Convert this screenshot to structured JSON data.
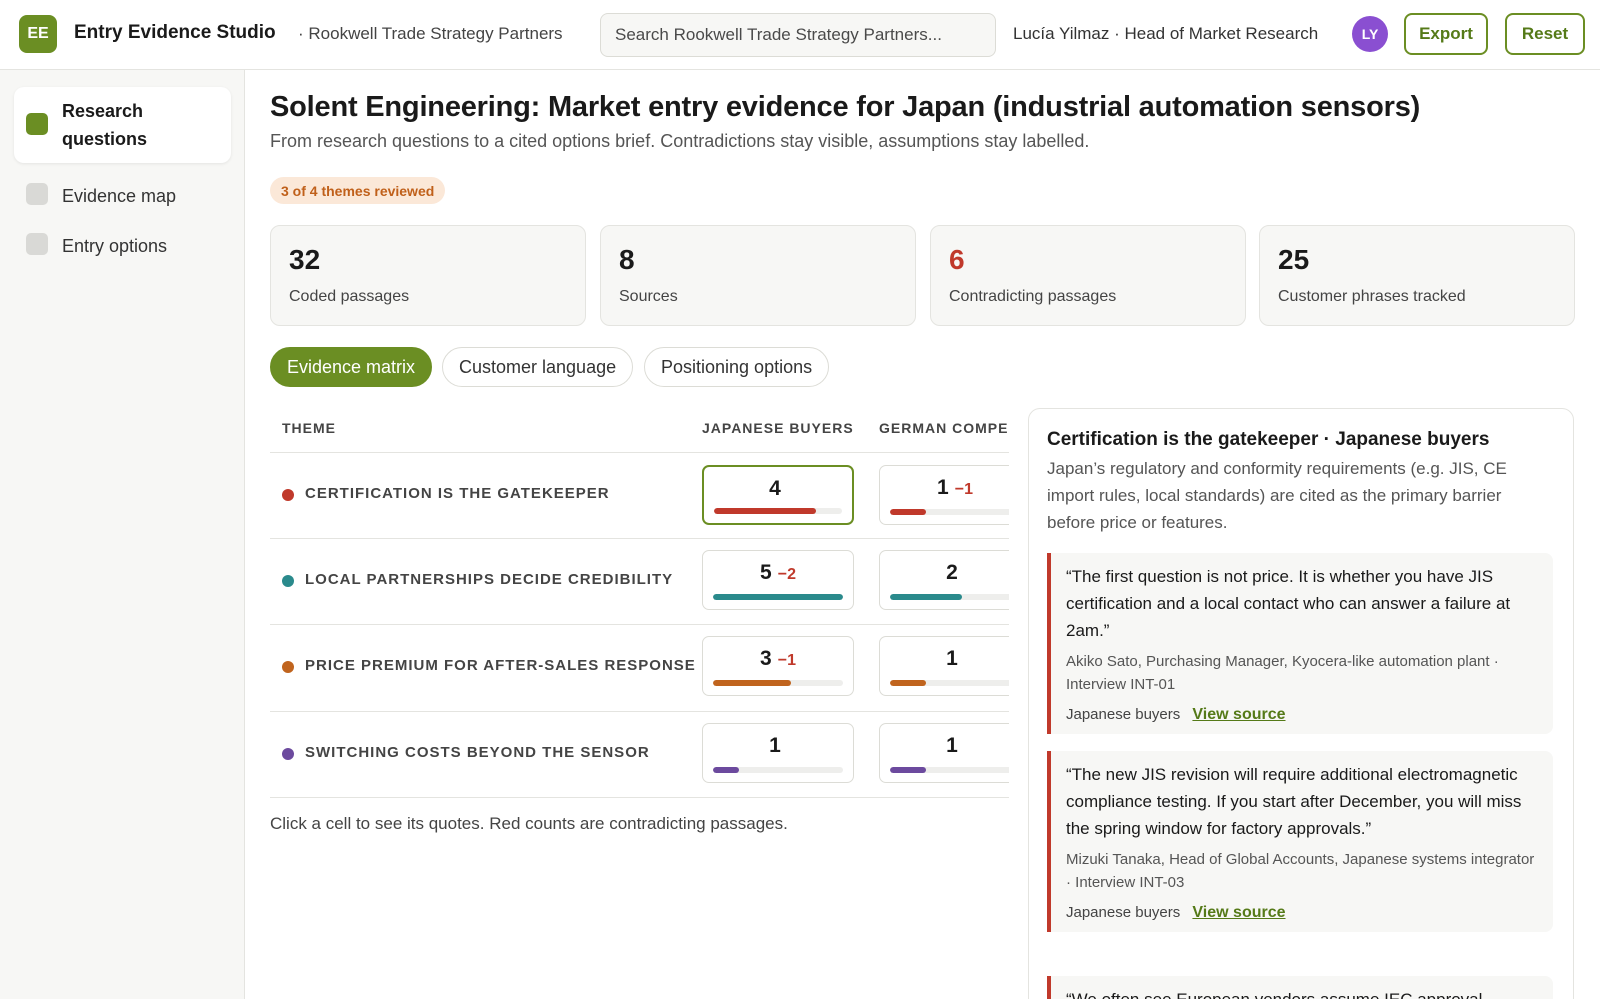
{
  "topbar": {
    "logo": "EE",
    "app_title": "Entry Evidence Studio",
    "org": "· Rookwell Trade Strategy Partners",
    "search_placeholder": "Search Rookwell Trade Strategy Partners...",
    "user": "Lucía Yilmaz · Head of Market Research",
    "avatar": "LY",
    "export_label": "Export",
    "reset_label": "Reset"
  },
  "sidebar": {
    "items": [
      {
        "label": "Research questions",
        "active": true
      },
      {
        "label": "Evidence map",
        "active": false
      },
      {
        "label": "Entry options",
        "active": false
      }
    ]
  },
  "main": {
    "title": "Solent Engineering: Market entry evidence for Japan (industrial automation sensors)",
    "subtitle": "From research questions to a cited options brief. Contradictions stay visible, assumptions stay labelled.",
    "review_badge": "3 of 4 themes reviewed",
    "stats": [
      {
        "value": "32",
        "label": "Coded passages",
        "highlight": false
      },
      {
        "value": "8",
        "label": "Sources",
        "highlight": false
      },
      {
        "value": "6",
        "label": "Contradicting passages",
        "highlight": true
      },
      {
        "value": "25",
        "label": "Customer phrases tracked",
        "highlight": false
      }
    ],
    "tabs": [
      {
        "label": "Evidence matrix",
        "active": true
      },
      {
        "label": "Customer language",
        "active": false
      },
      {
        "label": "Positioning options",
        "active": false
      }
    ]
  },
  "matrix": {
    "headers": [
      "THEME",
      "JAPANESE BUYERS",
      "GERMAN COMPE"
    ],
    "rows": [
      {
        "theme": "CERTIFICATION IS THE GATEKEEPER",
        "color": "#c0392b",
        "cells": [
          {
            "count": "4",
            "neg": "",
            "fill": 0.8
          },
          {
            "count": "1",
            "neg": "−1",
            "fill": 0.28
          }
        ]
      },
      {
        "theme": "LOCAL PARTNERSHIPS DECIDE CREDIBILITY",
        "color": "#2a8a8c",
        "cells": [
          {
            "count": "5",
            "neg": "−2",
            "fill": 1.0
          },
          {
            "count": "2",
            "neg": "",
            "fill": 0.55
          }
        ]
      },
      {
        "theme": "PRICE PREMIUM FOR AFTER-SALES RESPONSE",
        "color": "#c0641e",
        "cells": [
          {
            "count": "3",
            "neg": "−1",
            "fill": 0.6
          },
          {
            "count": "1",
            "neg": "",
            "fill": 0.28
          }
        ]
      },
      {
        "theme": "SWITCHING COSTS BEYOND THE SENSOR",
        "color": "#6c4a9e",
        "cells": [
          {
            "count": "1",
            "neg": "",
            "fill": 0.2
          },
          {
            "count": "1",
            "neg": "",
            "fill": 0.28
          }
        ]
      }
    ],
    "note": "Click a cell to see its quotes. Red counts are contradicting passages."
  },
  "panel": {
    "title": "Certification is the gatekeeper · Japanese buyers",
    "description": "Japan’s regulatory and conformity requirements (e.g. JIS, CE import rules, local standards) are cited as the primary barrier before price or features.",
    "quotes": [
      {
        "text": "“The first question is not price. It is whether you have JIS certification and a local contact who can answer a failure at 2am.”",
        "attribution": "Akiko Sato, Purchasing Manager, Kyocera-like automation plant · Interview INT-01",
        "segment": "Japanese buyers",
        "link": "View source"
      },
      {
        "text": "“The new JIS revision will require additional electromagnetic compliance testing. If you start after December, you will miss the spring window for factory approvals.”",
        "attribution": "Mizuki Tanaka, Head of Global Accounts, Japanese systems integrator · Interview INT-03",
        "segment": "Japanese buyers",
        "link": "View source"
      },
      {
        "text": "“We often see European vendors assume IEC approval",
        "attribution": "",
        "segment": "",
        "link": ""
      }
    ]
  }
}
